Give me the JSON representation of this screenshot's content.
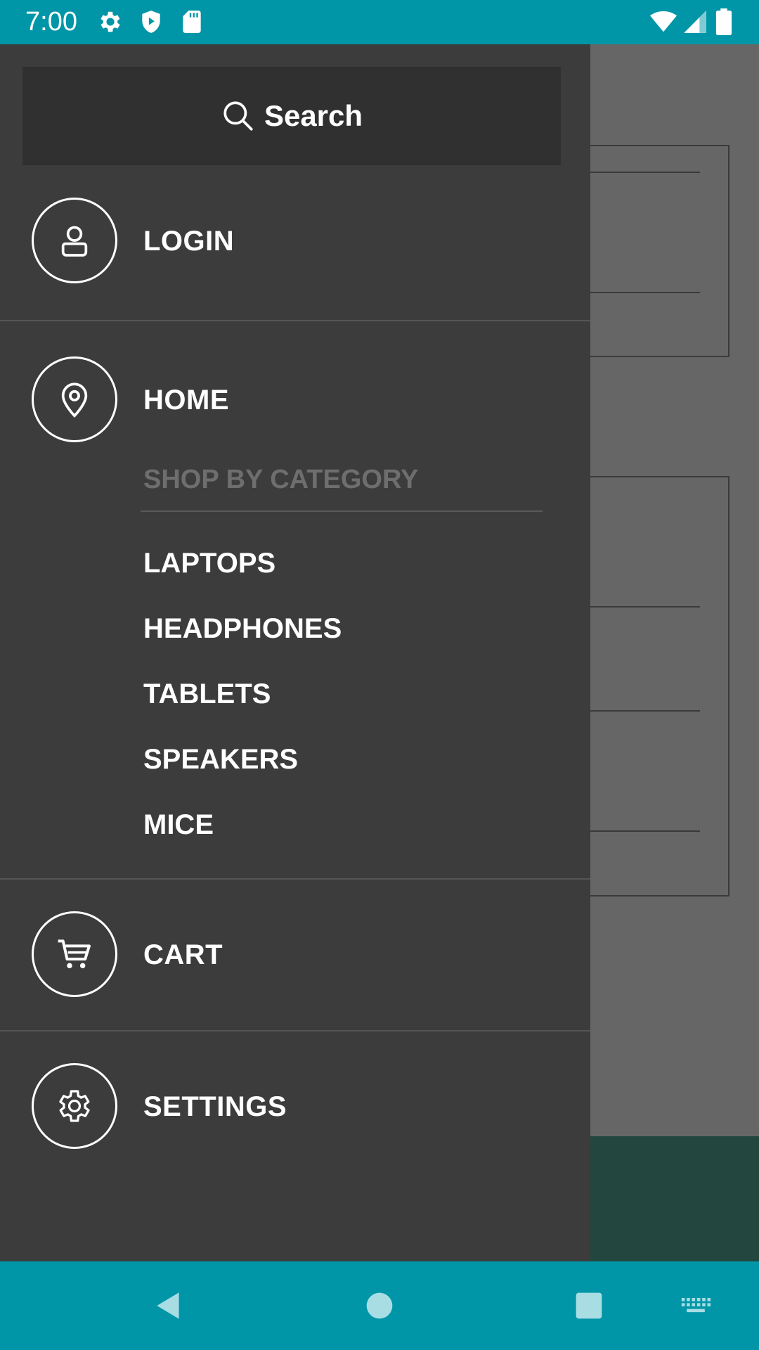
{
  "status_bar": {
    "time": "7:00",
    "icons_left": [
      "gear-icon",
      "shield-play-icon",
      "sd-card-icon"
    ],
    "icons_right": [
      "wifi-icon",
      "cell-signal-icon",
      "battery-icon"
    ]
  },
  "drawer": {
    "search": {
      "label": "Search",
      "icon": "search-icon"
    },
    "items": [
      {
        "label": "LOGIN",
        "icon": "user-icon"
      },
      {
        "label": "HOME",
        "icon": "location-pin-icon"
      },
      {
        "label": "CART",
        "icon": "cart-icon"
      },
      {
        "label": "SETTINGS",
        "icon": "gear-icon"
      }
    ],
    "category_header": "SHOP BY CATEGORY",
    "categories": [
      "LAPTOPS",
      "HEADPHONES",
      "TABLETS",
      "SPEAKERS",
      "MICE"
    ]
  },
  "nav_bar": {
    "buttons": [
      "back-icon",
      "home-icon",
      "recents-icon",
      "keyboard-icon"
    ]
  },
  "colors": {
    "system_bar": "#0096a7",
    "drawer_bg": "#3c3c3c",
    "search_bg": "#303030",
    "scrim": "#666666",
    "muted_text": "#6e6e6e"
  }
}
